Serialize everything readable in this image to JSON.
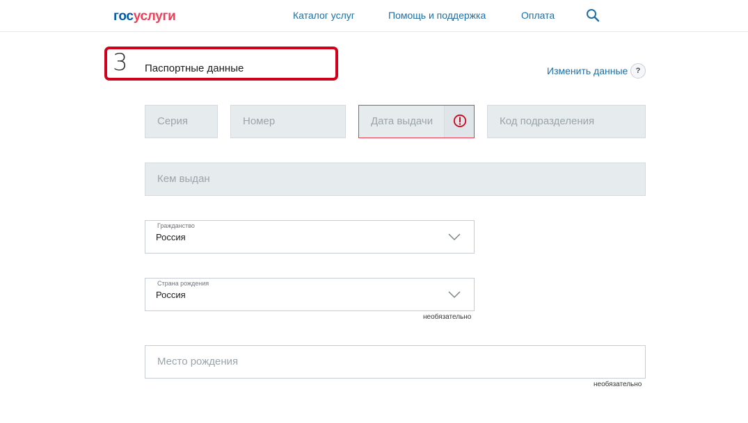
{
  "header": {
    "logo_part1": "гос",
    "logo_part2": "услуги",
    "nav": [
      {
        "label": "Каталог услуг"
      },
      {
        "label": "Помощь и поддержка"
      },
      {
        "label": "Оплата"
      }
    ],
    "search_icon": "search-icon"
  },
  "section": {
    "step_number": "3",
    "title": "Паспортные данные",
    "edit_link": "Изменить данные",
    "help_label": "?"
  },
  "form": {
    "series_placeholder": "Серия",
    "number_placeholder": "Номер",
    "issue_date_placeholder": "Дата выдачи",
    "division_code_placeholder": "Код подразделения",
    "issued_by_placeholder": "Кем выдан",
    "citizenship": {
      "label": "Гражданство",
      "value": "Россия"
    },
    "birth_country": {
      "label": "Страна рождения",
      "value": "Россия",
      "note": "необязательно"
    },
    "birthplace_placeholder": "Место рождения",
    "birthplace_note": "необязательно"
  },
  "colors": {
    "brand_blue": "#005ca9",
    "brand_red": "#ee3f58",
    "link_blue": "#1b6fa5",
    "error_red": "#e83a4a",
    "highlight_red": "#d0021b"
  }
}
